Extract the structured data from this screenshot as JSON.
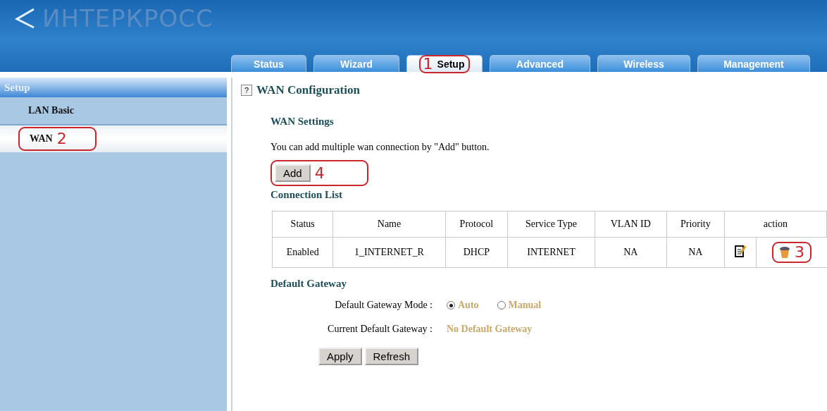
{
  "logo": {
    "text": "ИНТЕРКРОСС"
  },
  "tabs": [
    {
      "label": "Status",
      "selected": false
    },
    {
      "label": "Wizard",
      "selected": false
    },
    {
      "label": "Setup",
      "selected": true,
      "annotation": "1"
    },
    {
      "label": "Advanced",
      "selected": false
    },
    {
      "label": "Wireless",
      "selected": false
    },
    {
      "label": "Management",
      "selected": false
    }
  ],
  "sidebar": {
    "title": "Setup",
    "items": [
      {
        "label": "LAN Basic",
        "selected": false
      },
      {
        "label": "WAN",
        "selected": true,
        "annotation": "2"
      }
    ]
  },
  "content": {
    "title": "WAN Configuration",
    "help_icon": "?",
    "wan_settings": {
      "heading": "WAN Settings",
      "text": "You can add multiple wan connection by \"Add\" button.",
      "add_button": {
        "label": "Add",
        "annotation": "4"
      }
    },
    "connection_list": {
      "heading": "Connection List",
      "columns": [
        "Status",
        "Name",
        "Protocol",
        "Service Type",
        "VLAN ID",
        "Priority",
        "action"
      ],
      "rows": [
        {
          "cells": [
            "Enabled",
            "1_INTERNET_R",
            "DHCP",
            "INTERNET",
            "NA",
            "NA"
          ],
          "delete_annotation": "3"
        }
      ]
    },
    "default_gateway": {
      "heading": "Default Gateway",
      "mode_label": "Default Gateway Mode :",
      "modes": [
        {
          "label": "Auto",
          "selected": true
        },
        {
          "label": "Manual",
          "selected": false
        }
      ],
      "current_label": "Current Default Gateway :",
      "current_value": "No Default Gateway"
    },
    "buttons": [
      "Apply",
      "Refresh"
    ]
  }
}
